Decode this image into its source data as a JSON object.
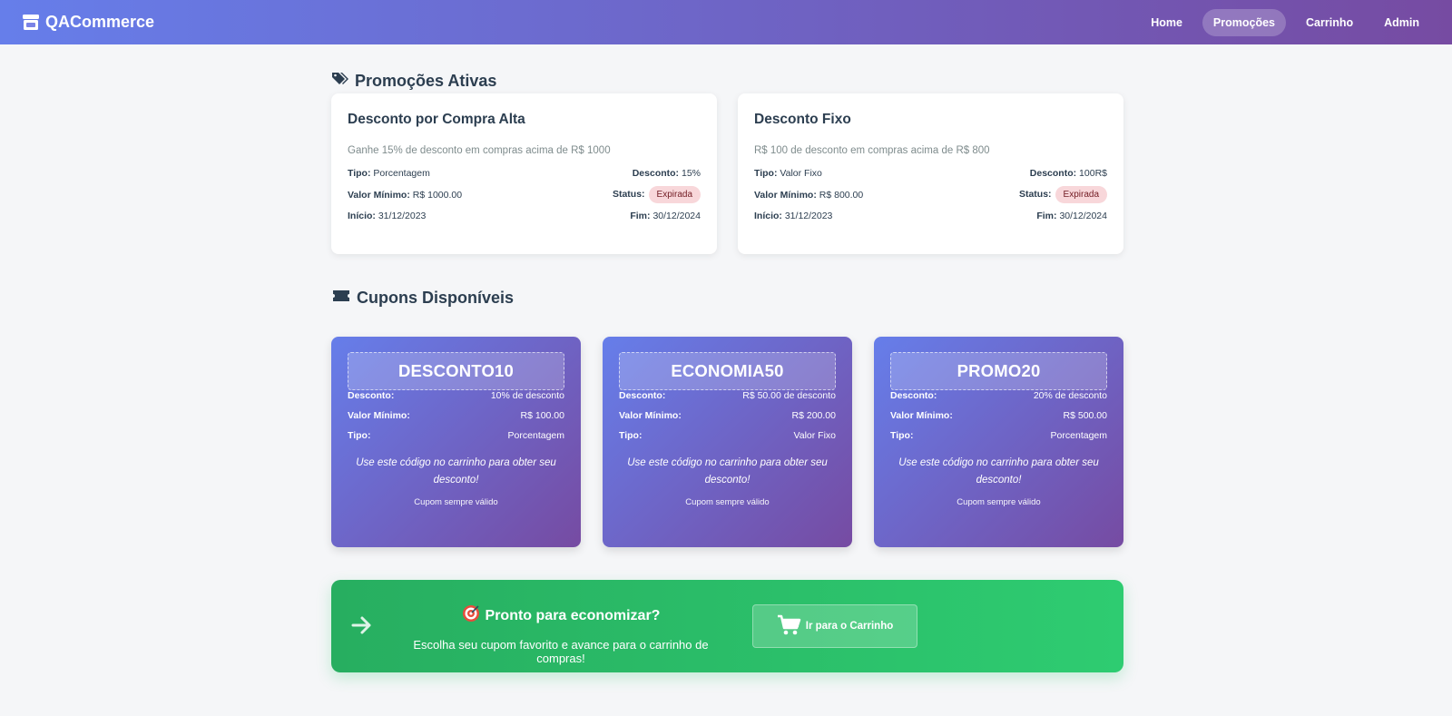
{
  "brand": {
    "name": "QACommerce",
    "icon": "store-icon"
  },
  "nav": {
    "items": [
      {
        "label": "Home",
        "active": false
      },
      {
        "label": "Promoções",
        "active": true
      },
      {
        "label": "Carrinho",
        "active": false
      },
      {
        "label": "Admin",
        "active": false
      }
    ]
  },
  "promotions": {
    "section_title": "Promoções Ativas",
    "icon": "tags-icon",
    "labels": {
      "tipo": "Tipo:",
      "desconto": "Desconto:",
      "valor_minimo": "Valor Mínimo:",
      "status": "Status:",
      "inicio": "Início:",
      "fim": "Fim:"
    },
    "cards": [
      {
        "title": "Desconto por Compra Alta",
        "description": "Ganhe 15% de desconto em compras acima de R$ 1000",
        "tipo": "Porcentagem",
        "desconto": "15%",
        "valor_minimo": "R$ 1000.00",
        "status": "Expirada",
        "inicio": "31/12/2023",
        "fim": "30/12/2024"
      },
      {
        "title": "Desconto Fixo",
        "description": "R$ 100 de desconto em compras acima de R$ 800",
        "tipo": "Valor Fixo",
        "desconto": "100R$",
        "valor_minimo": "R$ 800.00",
        "status": "Expirada",
        "inicio": "31/12/2023",
        "fim": "30/12/2024"
      }
    ]
  },
  "coupons": {
    "section_title": "Cupons Disponíveis",
    "icon": "ticket-icon",
    "labels": {
      "desconto": "Desconto:",
      "valor_minimo": "Valor Mínimo:",
      "tipo": "Tipo:"
    },
    "note": "Use este código no carrinho para obter seu desconto!",
    "validity": "Cupom sempre válido",
    "cards": [
      {
        "code": "DESCONTO10",
        "desconto": "10% de desconto",
        "valor_minimo": "R$ 100.00",
        "tipo": "Porcentagem"
      },
      {
        "code": "ECONOMIA50",
        "desconto": "R$ 50.00 de desconto",
        "valor_minimo": "R$ 200.00",
        "tipo": "Valor Fixo"
      },
      {
        "code": "PROMO20",
        "desconto": "20% de desconto",
        "valor_minimo": "R$ 500.00",
        "tipo": "Porcentagem"
      }
    ]
  },
  "cta": {
    "title": "Pronto para economizar?",
    "subtitle": "Escolha seu cupom favorito e avance para o carrinho de compras!",
    "button_label": "Ir para o Carrinho",
    "icons": [
      "arrow-right-icon",
      "target-icon",
      "cart-icon"
    ]
  },
  "colors": {
    "nav_start": "#667eea",
    "nav_end": "#764ba2",
    "cta_start": "#27ae60",
    "cta_end": "#2ecc71",
    "badge_bg": "#f8d7da",
    "badge_text": "#721c24"
  }
}
